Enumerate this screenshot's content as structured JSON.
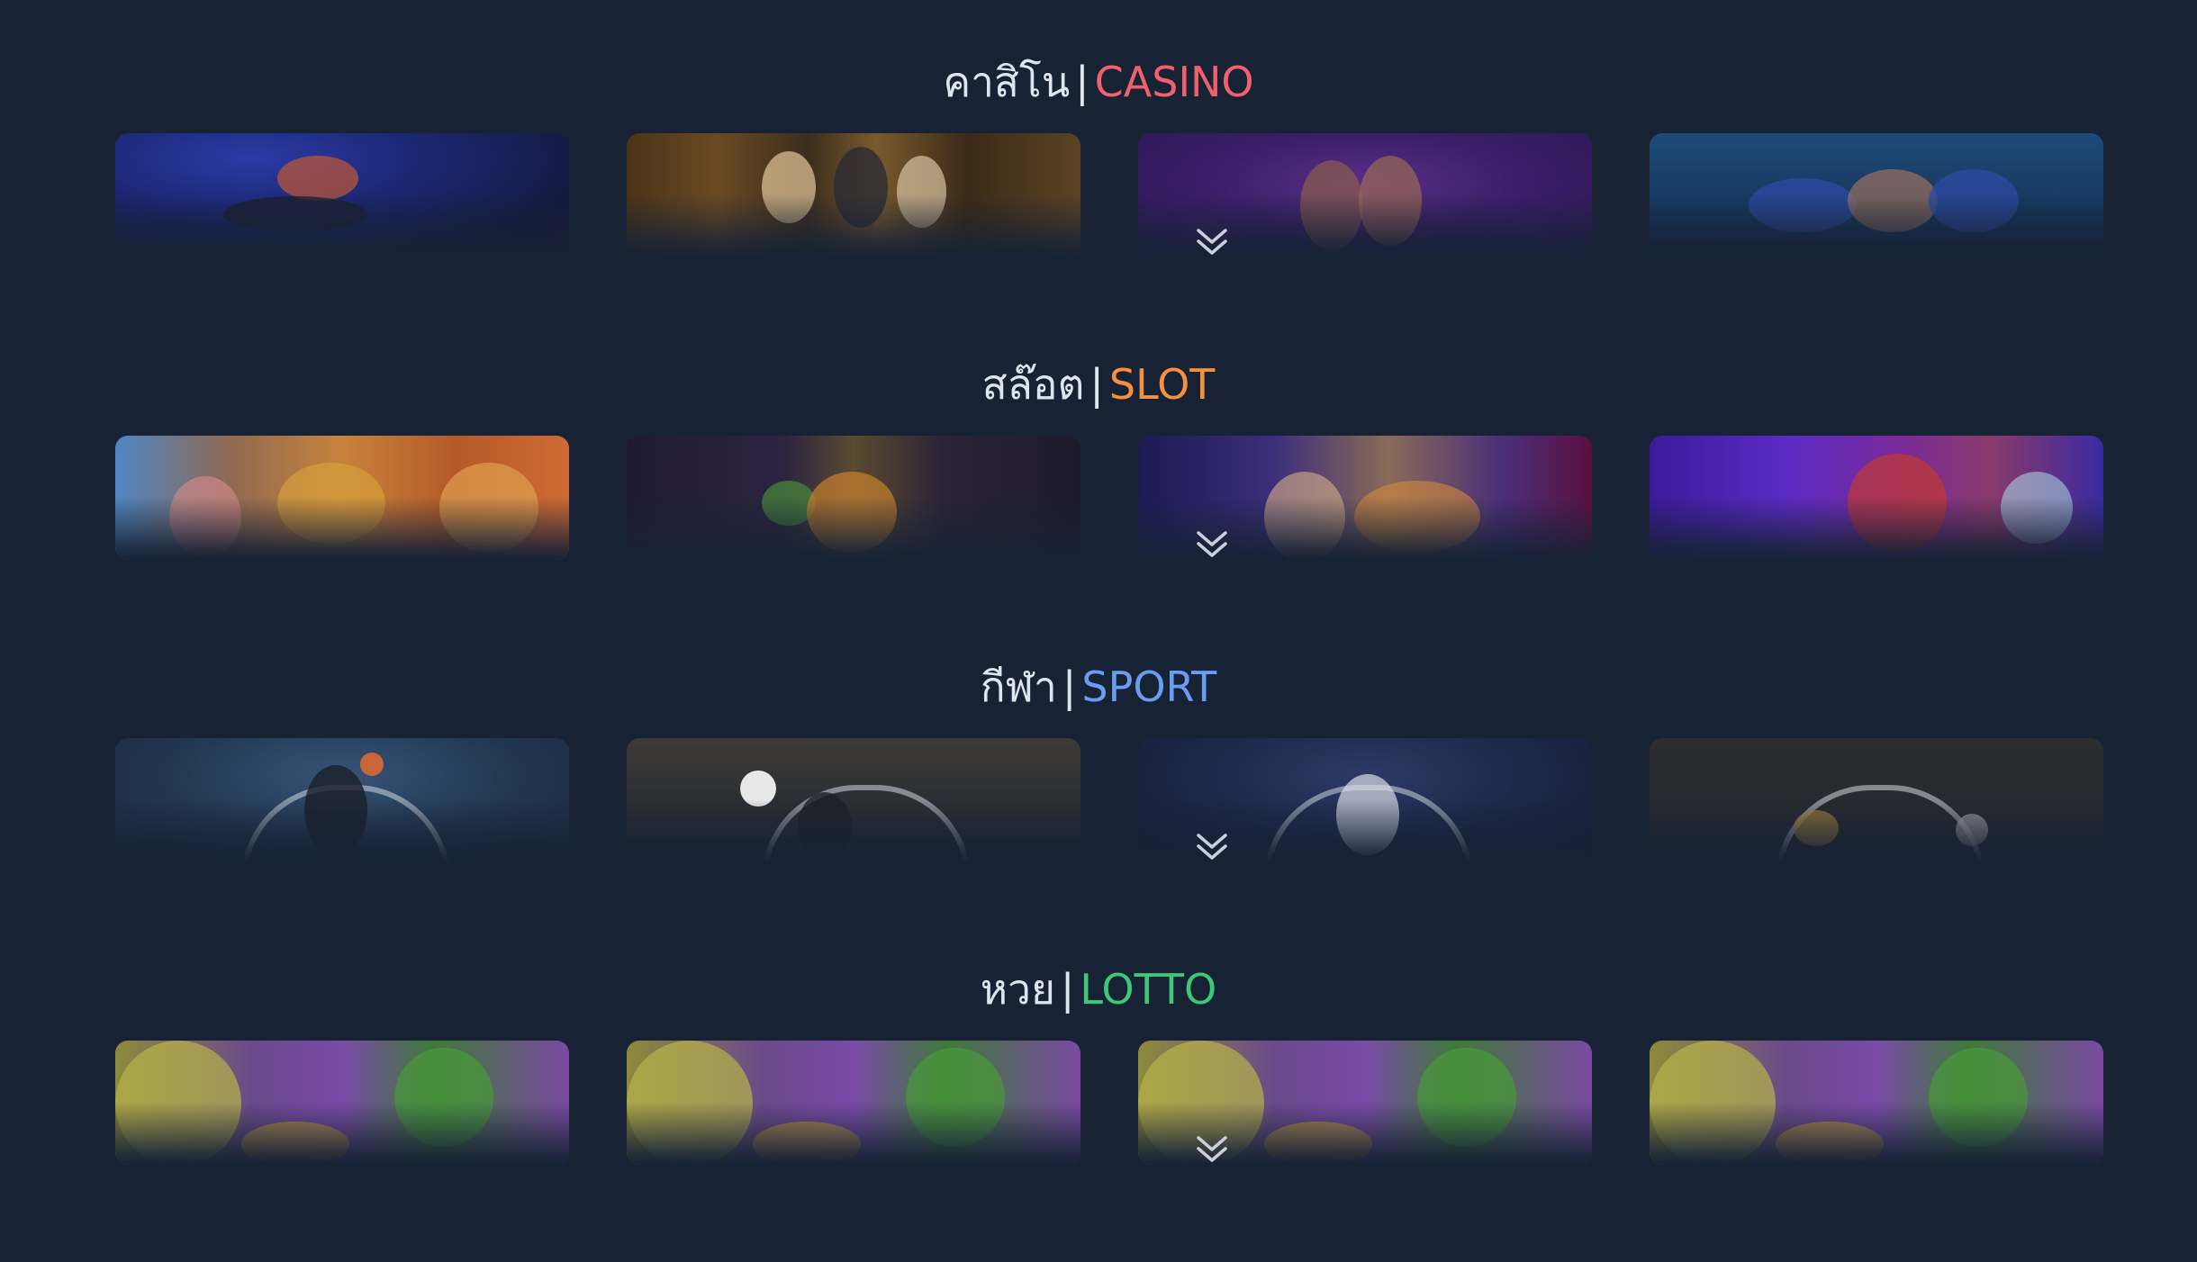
{
  "sections": [
    {
      "id": "casino",
      "title_th": "คาสิโน",
      "separator": "|",
      "title_en": "CASINO",
      "accent": "#f0616d",
      "cards": [
        "casino-card-1",
        "casino-card-2",
        "casino-card-3",
        "casino-card-4"
      ]
    },
    {
      "id": "slot",
      "title_th": "สล๊อต",
      "separator": "|",
      "title_en": "SLOT",
      "accent": "#f5903c",
      "cards": [
        "slot-card-1",
        "slot-card-2",
        "slot-card-3",
        "slot-card-4"
      ]
    },
    {
      "id": "sport",
      "title_th": "กีฬา",
      "separator": "|",
      "title_en": "SPORT",
      "accent": "#6a9cf2",
      "cards": [
        "sport-card-1",
        "sport-card-2",
        "sport-card-3",
        "sport-card-4"
      ]
    },
    {
      "id": "lotto",
      "title_th": "หวย",
      "separator": "|",
      "title_en": "LOTTO",
      "accent": "#3cc877",
      "cards": [
        "lotto-card-1",
        "lotto-card-2",
        "lotto-card-3",
        "lotto-card-4"
      ]
    }
  ],
  "icons": {
    "expand": "chevron-double-down-icon"
  },
  "colors": {
    "background": "#172235",
    "title_text": "#dfe5ee",
    "chevron": "#c9d0dc"
  }
}
